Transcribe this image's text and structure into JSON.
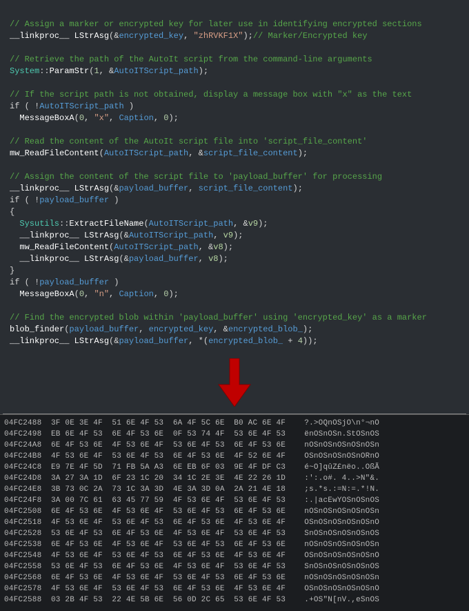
{
  "code": {
    "l1": "// Assign a marker or encrypted key for later use in identifying encrypted sections",
    "l2a": "__linkproc__",
    "l2b": " LStrAsg",
    "l2c": "(&",
    "l2d": "encrypted_key",
    "l2e": ", ",
    "l2f": "\"zhRVKF1X\"",
    "l2g": ");",
    "l2h": "// Marker/Encrypted key",
    "l3": "// Retrieve the path of the AutoIt script from the command-line arguments",
    "l4a": "System",
    "l4b": "::",
    "l4c": "ParamStr",
    "l4d": "(",
    "l4e": "1",
    "l4f": ", &",
    "l4g": "AutoITScript_path",
    "l4h": ");",
    "l5": "// If the script path is not obtained, display a message box with \"x\" as the text",
    "l6a": "if",
    "l6b": " ( !",
    "l6c": "AutoITScript_path",
    "l6d": " )",
    "l7a": "  MessageBoxA",
    "l7b": "(",
    "l7c": "0",
    "l7d": ", ",
    "l7e": "\"x\"",
    "l7f": ", ",
    "l7g": "Caption",
    "l7h": ", ",
    "l7i": "0",
    "l7j": ");",
    "l8": "// Read the content of the AutoIt script file into 'script_file_content'",
    "l9a": "mw_ReadFileContent",
    "l9b": "(",
    "l9c": "AutoITScript_path",
    "l9d": ", &",
    "l9e": "script_file_content",
    "l9f": ");",
    "l10": "// Assign the content of the script file to 'payload_buffer' for processing",
    "l11a": "__linkproc__",
    "l11b": " LStrAsg",
    "l11c": "(&",
    "l11d": "payload_buffer",
    "l11e": ", ",
    "l11f": "script_file_content",
    "l11g": ");",
    "l12a": "if",
    "l12b": " ( !",
    "l12c": "payload_buffer",
    "l12d": " )",
    "l13": "{",
    "l14a": "  Sysutils",
    "l14b": "::",
    "l14c": "ExtractFileName",
    "l14d": "(",
    "l14e": "AutoITScript_path",
    "l14f": ", &",
    "l14g": "v9",
    "l14h": ");",
    "l15a": "  __linkproc__",
    "l15b": " LStrAsg",
    "l15c": "(&",
    "l15d": "AutoITScript_path",
    "l15e": ", ",
    "l15f": "v9",
    "l15g": ");",
    "l16a": "  mw_ReadFileContent",
    "l16b": "(",
    "l16c": "AutoITScript_path",
    "l16d": ", &",
    "l16e": "v8",
    "l16f": ");",
    "l17a": "  __linkproc__",
    "l17b": " LStrAsg",
    "l17c": "(&",
    "l17d": "payload_buffer",
    "l17e": ", ",
    "l17f": "v8",
    "l17g": ");",
    "l18": "}",
    "l19a": "if",
    "l19b": " ( !",
    "l19c": "payload_buffer",
    "l19d": " )",
    "l20a": "  MessageBoxA",
    "l20b": "(",
    "l20c": "0",
    "l20d": ", ",
    "l20e": "\"n\"",
    "l20f": ", ",
    "l20g": "Caption",
    "l20h": ", ",
    "l20i": "0",
    "l20j": ");",
    "l21": "// Find the encrypted blob within 'payload_buffer' using 'encrypted_key' as a marker",
    "l22a": "blob_finder",
    "l22b": "(",
    "l22c": "payload_buffer",
    "l22d": ", ",
    "l22e": "encrypted_key",
    "l22f": ", &",
    "l22g": "encrypted_blob_",
    "l22h": ");",
    "l23a": "__linkproc__",
    "l23b": " LStrAsg",
    "l23c": "(&",
    "l23d": "payload_buffer",
    "l23e": ", *(",
    "l23f": "encrypted_blob_",
    "l23g": " + ",
    "l23h": "4",
    "l23i": "));"
  },
  "hex": [
    {
      "a": "04FC2488",
      "b": "3F 0E 3E 4F 51 6E 4F 53 6A 4F 5C 6E B0 AC 6E 4F",
      "c": "?.>OQnOSjO\\n°¬nO"
    },
    {
      "a": "04FC2498",
      "b": "EB 6E 4F 53 6E 4F 53 6E 0F 53 74 4F 53 6E 4F 53",
      "c": "ënOSnOSn.StOSnOS"
    },
    {
      "a": "04FC24A8",
      "b": "6E 4F 53 6E 4F 53 6E 4F 53 6E 4F 53 6E 4F 53 6E",
      "c": "nOSnOSnOSnOSnOSn"
    },
    {
      "a": "04FC24B8",
      "b": "4F 53 6E 4F 53 6E 4F 53 6E 4F 53 6E 4F 52 6E 4F",
      "c": "OSnOSnOSnOSnORnO"
    },
    {
      "a": "04FC24C8",
      "b": "E9 7E 4F 5D 71 FB 5A A3 6E EB 6F 03 9E 4F DF C3",
      "c": "é~O]qûZ£nëo..OßÃ"
    },
    {
      "a": "04FC24D8",
      "b": "3A 27 3A 1D 6F 23 1C 20 34 1C 2E 3E 4E 22 26 1D",
      "c": ":':.o#. 4..>N\"&."
    },
    {
      "a": "04FC24E8",
      "b": "3B 73 0C 2A 73 1C 3A 3D 4E 3A 3D 0A 2A 21 4E 18",
      "c": ";s.*s.:=N:=.*!N."
    },
    {
      "a": "04FC24F8",
      "b": "3A 00 7C 61 63 45 77 59 4F 53 6E 4F 53 6E 4F 53",
      "c": ":.|acEwYOSnOSnOS"
    },
    {
      "a": "04FC2508",
      "b": "6E 4F 53 6E 4F 53 6E 4F 53 6E 4F 53 6E 4F 53 6E",
      "c": "nOSnOSnOSnOSnOSn"
    },
    {
      "a": "04FC2518",
      "b": "4F 53 6E 4F 53 6E 4F 53 6E 4F 53 6E 4F 53 6E 4F",
      "c": "OSnOSnOSnOSnOSnO"
    },
    {
      "a": "04FC2528",
      "b": "53 6E 4F 53 6E 4F 53 6E 4F 53 6E 4F 53 6E 4F 53",
      "c": "SnOSnOSnOSnOSnOS"
    },
    {
      "a": "04FC2538",
      "b": "6E 4F 53 6E 4F 53 6E 4F 53 6E 4F 53 6E 4F 53 6E",
      "c": "nOSnOSnOSnOSnOSn"
    },
    {
      "a": "04FC2548",
      "b": "4F 53 6E 4F 53 6E 4F 53 6E 4F 53 6E 4F 53 6E 4F",
      "c": "OSnOSnOSnOSnOSnO"
    },
    {
      "a": "04FC2558",
      "b": "53 6E 4F 53 6E 4F 53 6E 4F 53 6E 4F 53 6E 4F 53",
      "c": "SnOSnOSnOSnOSnOS"
    },
    {
      "a": "04FC2568",
      "b": "6E 4F 53 6E 4F 53 6E 4F 53 6E 4F 53 6E 4F 53 6E",
      "c": "nOSnOSnOSnOSnOSn"
    },
    {
      "a": "04FC2578",
      "b": "4F 53 6E 4F 53 6E 4F 53 6E 4F 53 6E 4F 53 6E 4F",
      "c": "OSnOSnOSnOSnOSnO"
    },
    {
      "a": "04FC2588",
      "b": "03 2B 4F 53 22 4E 5B 6E 56 0D 2C 65 53 6E 4F 53",
      "c": ".+OS\"N[nV.,eSnOS"
    }
  ]
}
